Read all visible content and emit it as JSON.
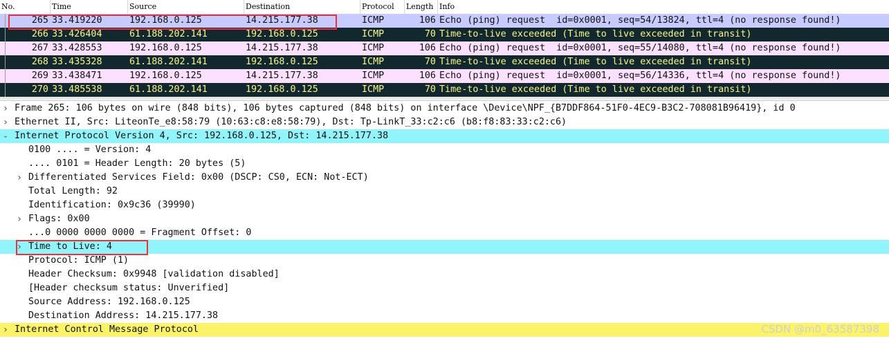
{
  "columns": [
    "No.",
    "Time",
    "Source",
    "Destination",
    "Protocol",
    "Length",
    "Info"
  ],
  "packets": [
    {
      "no": "265",
      "time": "33.419220",
      "src": "192.168.0.125",
      "dst": "14.215.177.38",
      "proto": "ICMP",
      "len": "106",
      "info": "Echo (ping) request  id=0x0001, seq=54/13824, ttl=4 (no response found!)",
      "kind": "sel"
    },
    {
      "no": "266",
      "time": "33.426404",
      "src": "61.188.202.141",
      "dst": "192.168.0.125",
      "proto": "ICMP",
      "len": "70",
      "info": "Time-to-live exceeded (Time to live exceeded in transit)",
      "kind": "ttl"
    },
    {
      "no": "267",
      "time": "33.428553",
      "src": "192.168.0.125",
      "dst": "14.215.177.38",
      "proto": "ICMP",
      "len": "106",
      "info": "Echo (ping) request  id=0x0001, seq=55/14080, ttl=4 (no response found!)",
      "kind": "req"
    },
    {
      "no": "268",
      "time": "33.435328",
      "src": "61.188.202.141",
      "dst": "192.168.0.125",
      "proto": "ICMP",
      "len": "70",
      "info": "Time-to-live exceeded (Time to live exceeded in transit)",
      "kind": "ttl"
    },
    {
      "no": "269",
      "time": "33.438471",
      "src": "192.168.0.125",
      "dst": "14.215.177.38",
      "proto": "ICMP",
      "len": "106",
      "info": "Echo (ping) request  id=0x0001, seq=56/14336, ttl=4 (no response found!)",
      "kind": "req"
    },
    {
      "no": "270",
      "time": "33.485538",
      "src": "61.188.202.141",
      "dst": "192.168.0.125",
      "proto": "ICMP",
      "len": "70",
      "info": "Time-to-live exceeded (Time to live exceeded in transit)",
      "kind": "ttl"
    }
  ],
  "details": [
    {
      "text": "Frame 265: 106 bytes on wire (848 bits), 106 bytes captured (848 bits) on interface \\Device\\NPF_{B7DDF864-51F0-4EC9-B3C2-708081B96419}, id 0",
      "depth": 0,
      "twisty": "collapsed",
      "hl": ""
    },
    {
      "text": "Ethernet II, Src: LiteonTe_e8:58:79 (10:63:c8:e8:58:79), Dst: Tp-LinkT_33:c2:c6 (b8:f8:83:33:c2:c6)",
      "depth": 0,
      "twisty": "collapsed",
      "hl": ""
    },
    {
      "text": "Internet Protocol Version 4, Src: 192.168.0.125, Dst: 14.215.177.38",
      "depth": 0,
      "twisty": "expanded",
      "hl": "cyan"
    },
    {
      "text": "0100 .... = Version: 4",
      "depth": 1,
      "twisty": "",
      "hl": ""
    },
    {
      "text": ".... 0101 = Header Length: 20 bytes (5)",
      "depth": 1,
      "twisty": "",
      "hl": ""
    },
    {
      "text": "Differentiated Services Field: 0x00 (DSCP: CS0, ECN: Not-ECT)",
      "depth": 1,
      "twisty": "collapsed",
      "hl": ""
    },
    {
      "text": "Total Length: 92",
      "depth": 1,
      "twisty": "",
      "hl": ""
    },
    {
      "text": "Identification: 0x9c36 (39990)",
      "depth": 1,
      "twisty": "",
      "hl": ""
    },
    {
      "text": "Flags: 0x00",
      "depth": 1,
      "twisty": "collapsed",
      "hl": ""
    },
    {
      "text": "...0 0000 0000 0000 = Fragment Offset: 0",
      "depth": 1,
      "twisty": "",
      "hl": ""
    },
    {
      "text": "Time to Live: 4",
      "depth": 1,
      "twisty": "collapsed",
      "hl": "cyan"
    },
    {
      "text": "Protocol: ICMP (1)",
      "depth": 1,
      "twisty": "",
      "hl": ""
    },
    {
      "text": "Header Checksum: 0x9948 [validation disabled]",
      "depth": 1,
      "twisty": "",
      "hl": ""
    },
    {
      "text": "[Header checksum status: Unverified]",
      "depth": 1,
      "twisty": "",
      "hl": ""
    },
    {
      "text": "Source Address: 192.168.0.125",
      "depth": 1,
      "twisty": "",
      "hl": ""
    },
    {
      "text": "Destination Address: 14.215.177.38",
      "depth": 1,
      "twisty": "",
      "hl": ""
    },
    {
      "text": "Internet Control Message Protocol",
      "depth": 0,
      "twisty": "collapsed",
      "hl": "yellow"
    }
  ],
  "icons": {
    "collapsed": "chevron-right-icon",
    "expanded": "chevron-down-icon"
  },
  "watermark": "CSDN @m0_63587398",
  "colors": {
    "selected_row": "#c7cbff",
    "request_row": "#fce0ff",
    "ttl_row_bg": "#12272e",
    "ttl_row_fg": "#f7f787",
    "highlight_cyan": "#92f4fb",
    "highlight_yellow": "#fbf36a",
    "annotation_box": "#e8313a"
  }
}
